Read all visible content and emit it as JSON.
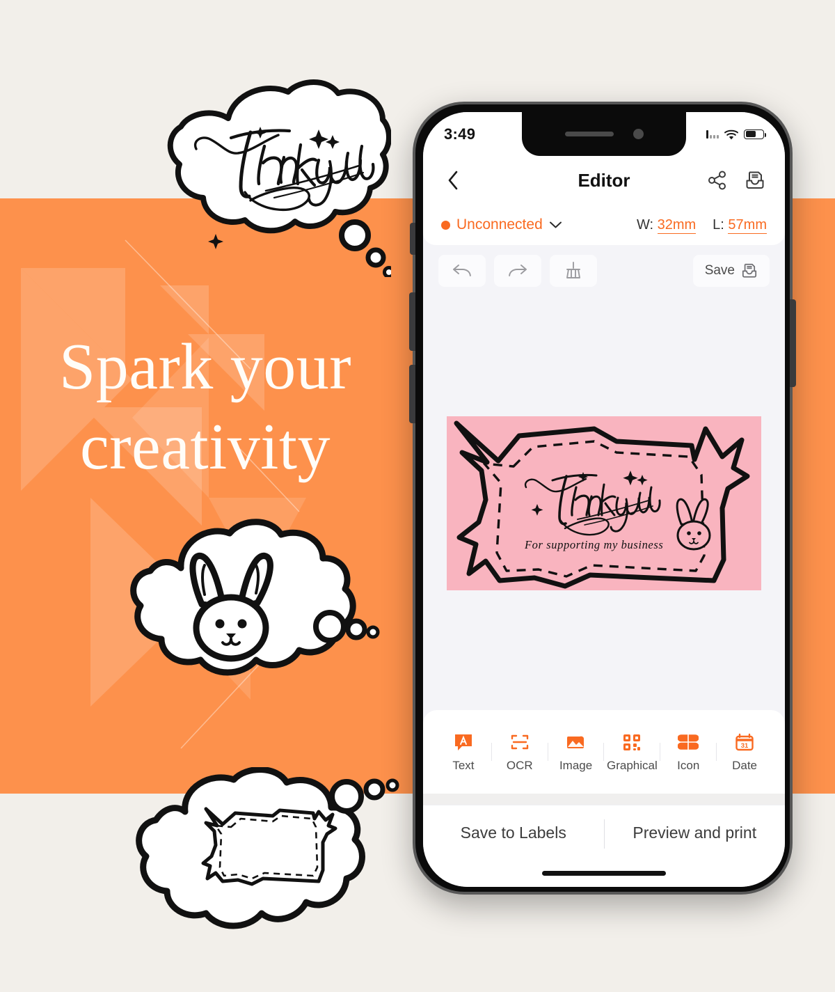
{
  "promo": {
    "headline_line1": "Spark your",
    "headline_line2": "creativity",
    "background_color": "#fd914c",
    "page_background": "#f2efea",
    "bubble_top_text": "Thank you",
    "bubble_middle_icon": "bunny-icon",
    "bubble_bottom_icon": "label-shape-icon"
  },
  "phone": {
    "status_bar": {
      "time": "3:49",
      "signal_icon": "signal-bars-icon",
      "wifi_icon": "wifi-icon",
      "battery_icon": "battery-icon"
    },
    "nav": {
      "back_icon": "chevron-left-icon",
      "title": "Editor",
      "share_icon": "share-icon",
      "archive_icon": "archive-inbox-icon"
    },
    "status_row": {
      "connection_label": "Unconnected",
      "connection_dot_color": "#f96a21",
      "chevron_icon": "chevron-down-icon",
      "width_prefix": "W:",
      "width_value": "32mm",
      "length_prefix": "L:",
      "length_value": "57mm"
    },
    "edit_toolbar": {
      "undo_icon": "undo-arrow-icon",
      "redo_icon": "redo-arrow-icon",
      "clear_icon": "broom-icon",
      "save_label": "Save",
      "save_icon": "archive-inbox-icon"
    },
    "canvas": {
      "label_background": "#f9b4bf",
      "headline_text": "Thank you",
      "subtext": "For supporting my business",
      "bunny_icon": "bunny-icon"
    },
    "bottom_tools": [
      {
        "label": "Text",
        "icon": "text-bubble-a-icon"
      },
      {
        "label": "OCR",
        "icon": "scan-frame-icon"
      },
      {
        "label": "Image",
        "icon": "photo-mountain-icon"
      },
      {
        "label": "Graphical",
        "icon": "qr-code-icon"
      },
      {
        "label": "Icon",
        "icon": "clover-shape-icon"
      },
      {
        "label": "Date",
        "icon": "calendar-31-icon"
      }
    ],
    "actions": {
      "save_to_labels": "Save to Labels",
      "preview_and_print": "Preview and print"
    },
    "accent_color": "#f96a21"
  }
}
